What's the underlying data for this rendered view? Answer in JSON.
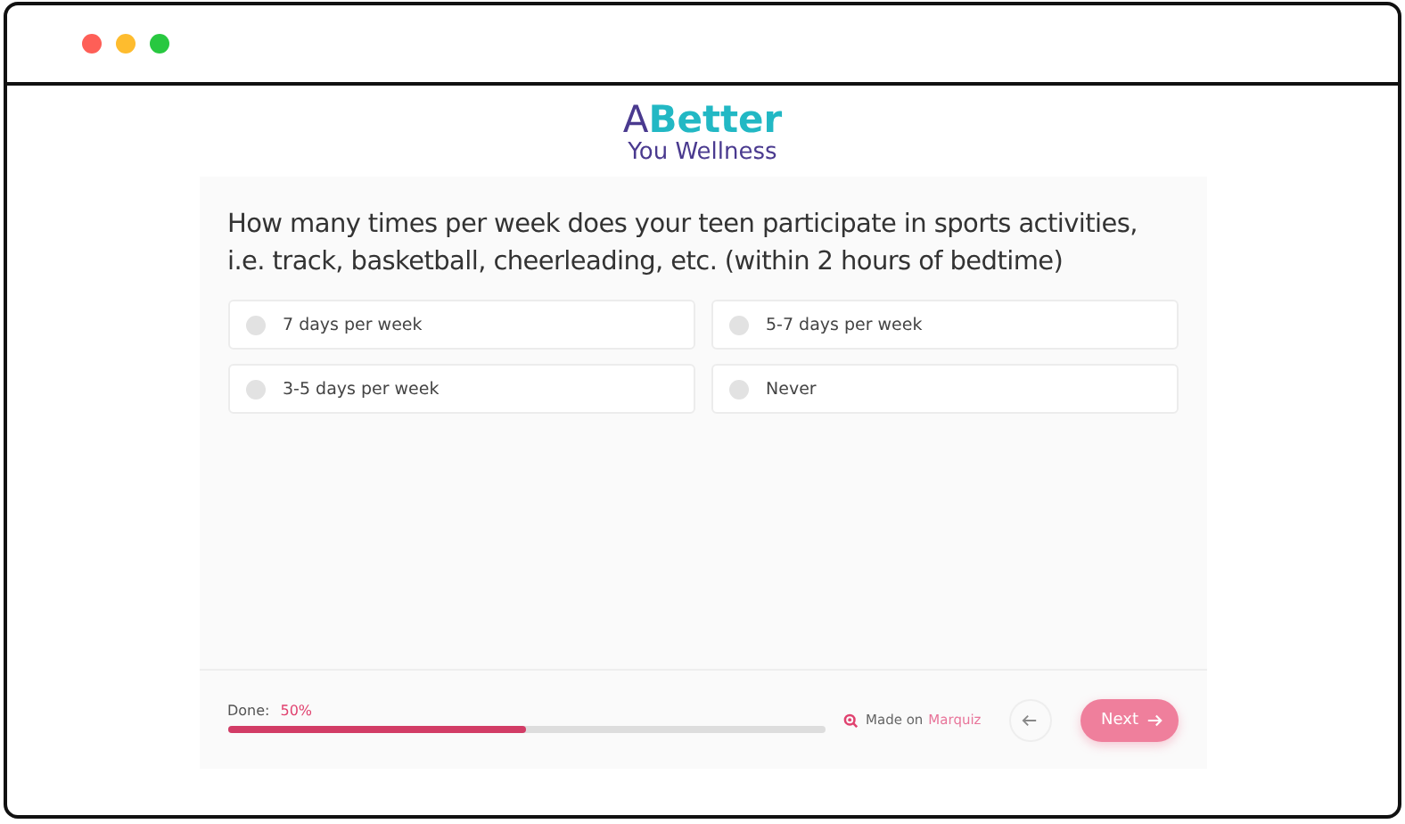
{
  "logo": {
    "letter": "A",
    "word": "Better",
    "subtitle": "You Wellness"
  },
  "question": "How many times per week does your teen participate in sports activities, i.e. track, basketball, cheerleading, etc. (within 2 hours of bedtime)",
  "options": [
    {
      "label": "7 days per week",
      "selected": false
    },
    {
      "label": "5-7 days per week",
      "selected": false
    },
    {
      "label": "3-5 days per week",
      "selected": false
    },
    {
      "label": "Never",
      "selected": false
    }
  ],
  "progress": {
    "label": "Done:",
    "value": "50%",
    "level": 0.5
  },
  "credit": {
    "text": "Made on",
    "link": "Marquiz"
  },
  "next_button": "Next"
}
